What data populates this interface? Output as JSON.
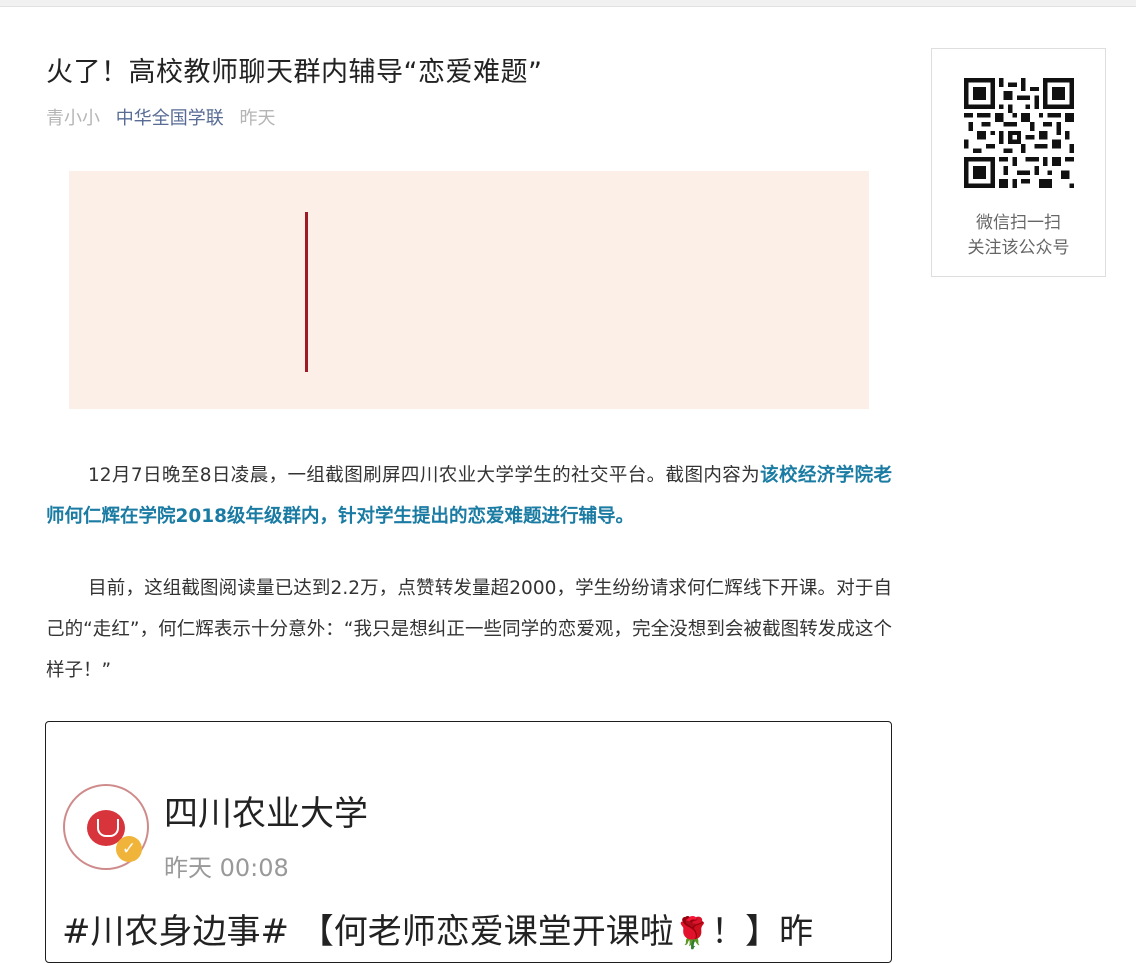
{
  "article": {
    "title": "火了！高校教师聊天群内辅导“恋爱难题”",
    "author": "青小小",
    "account": "中华全国学联",
    "date": "昨天",
    "p1_text": "12月7日晚至8日凌晨，一组截图刷屏四川农业大学学生的社交平台。截图内容为",
    "p1_highlight": "该校经济学院老师何仁辉在学院2018级年级群内，针对学生提出的恋爱难题进行辅导。",
    "p2_text": "目前，这组截图阅读量已达到2.2万，点赞转发量超2000，学生纷纷请求何仁辉线下开课。对于自己的“走红”，何仁辉表示十分意外：“我只是想纠正一些同学的恋爱观，完全没想到会被截图转发成这个样子！”"
  },
  "screenshot": {
    "org_name": "四川农业大学",
    "post_time": "昨天 00:08",
    "post_start": "#川农身边事#  【何老师恋爱课堂开课啦",
    "post_end": "！】昨"
  },
  "qr": {
    "line1": "微信扫一扫",
    "line2": "关注该公众号"
  },
  "icons": {
    "qr": "qr-code-icon",
    "logo": "university-logo-icon",
    "verified": "verified-badge-icon",
    "rose": "rose-icon"
  },
  "colors": {
    "account_link": "#576b95",
    "highlight": "#1a7ba3",
    "banner_bg": "#fbefe7",
    "banner_line": "#9e1b25"
  }
}
